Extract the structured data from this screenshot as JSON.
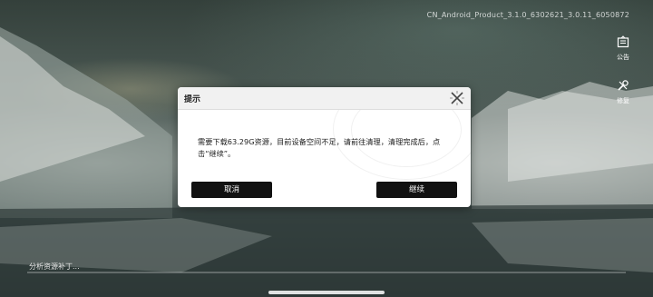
{
  "version_label": "CN_Android_Product_3.1.0_6302621_3.0.11_6050872",
  "side_buttons": {
    "notice_label": "公告",
    "repair_label": "修复"
  },
  "dialog": {
    "title": "提示",
    "message": "需要下载63.29G资源，目前设备空间不足，请前往清理，清理完成后，点击“继续”。",
    "cancel_label": "取消",
    "continue_label": "继续"
  },
  "status": {
    "text": "分析资源补丁...",
    "progress": 0
  },
  "icons": {
    "notice": "notice-icon",
    "repair": "wrench-icon",
    "close": "close-icon"
  }
}
